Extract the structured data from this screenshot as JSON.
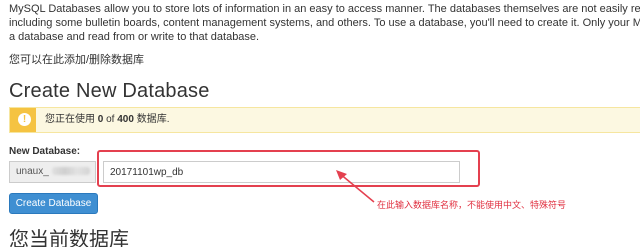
{
  "intro": {
    "lines": [
      "MySQL Databases allow you to store lots of information in an easy to access manner. The databases themselves are not easily read by humans. M",
      "including some bulletin boards, content management systems, and others. To use a database, you'll need to create it. Only your MySQL Usernam",
      "a database and read from or write to that database."
    ]
  },
  "add_delete_text": "您可以在此添加/删除数据库",
  "create_section": {
    "heading": "Create New Database",
    "notice": {
      "icon": "exclamation-icon",
      "prefix": "您正在使用",
      "used": "0",
      "of": "of",
      "total": "400",
      "suffix": "数据库."
    },
    "new_db_label": "New Database:",
    "db_prefix": "unaux_",
    "db_prefix_end": "_",
    "db_name_value": "20171101wp_db",
    "create_button": "Create Database"
  },
  "annotation": {
    "text": "在此输入数据库名称，不能使用中文、特殊符号",
    "color": "#e03040"
  },
  "current_section": {
    "heading": "您当前数据库"
  },
  "colors": {
    "notice_bg": "#fcf8e1",
    "notice_icon": "#f5c342",
    "button": "#3f8fd2",
    "highlight": "#e4404f"
  }
}
